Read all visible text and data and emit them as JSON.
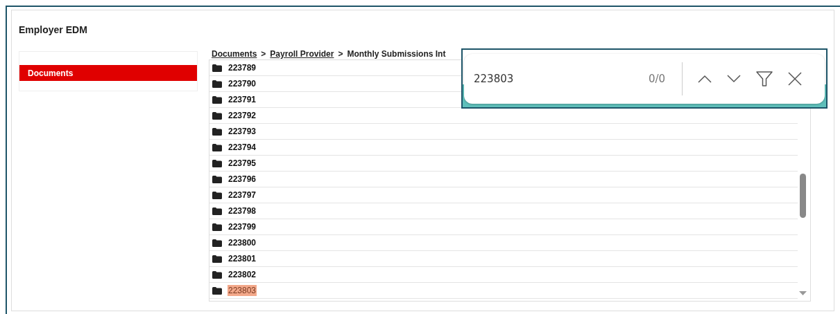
{
  "panel": {
    "title": "Employer EDM"
  },
  "sidebar": {
    "items": [
      {
        "label": "Documents",
        "selected": true
      }
    ]
  },
  "breadcrumb": [
    {
      "label": "Documents",
      "kind": "link"
    },
    {
      "label": "Payroll Provider",
      "kind": "link",
      "separator": ">"
    },
    {
      "label": "Monthly Submissions Int",
      "kind": "current",
      "separator": ">"
    }
  ],
  "folders": [
    {
      "name": "223789",
      "highlighted": false
    },
    {
      "name": "223790",
      "highlighted": false
    },
    {
      "name": "223791",
      "highlighted": false
    },
    {
      "name": "223792",
      "highlighted": false
    },
    {
      "name": "223793",
      "highlighted": false
    },
    {
      "name": "223794",
      "highlighted": false
    },
    {
      "name": "223795",
      "highlighted": false
    },
    {
      "name": "223796",
      "highlighted": false
    },
    {
      "name": "223797",
      "highlighted": false
    },
    {
      "name": "223798",
      "highlighted": false
    },
    {
      "name": "223799",
      "highlighted": false
    },
    {
      "name": "223800",
      "highlighted": false
    },
    {
      "name": "223801",
      "highlighted": false
    },
    {
      "name": "223802",
      "highlighted": false
    },
    {
      "name": "223803",
      "highlighted": true
    }
  ],
  "find_bar": {
    "value": "223803",
    "count": "0/0"
  }
}
